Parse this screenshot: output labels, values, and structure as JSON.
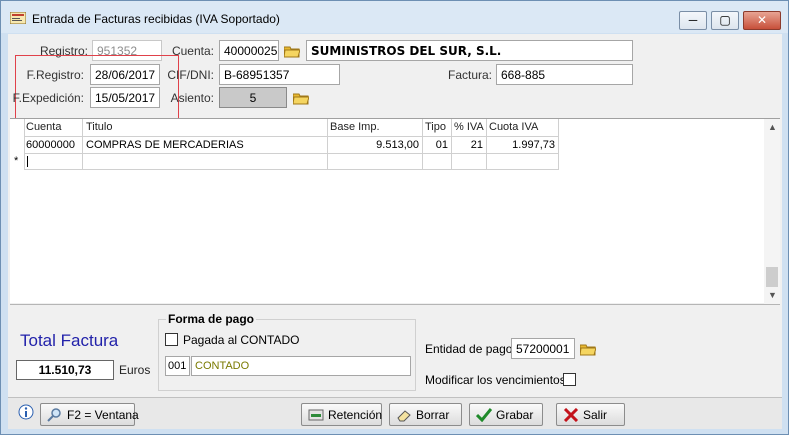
{
  "window": {
    "title": "Entrada de Facturas recibidas (IVA Soportado)",
    "controls": {
      "minimize": "─",
      "maximize": "▢",
      "close": "✕"
    }
  },
  "header": {
    "registro_label": "Registro:",
    "registro_value": "951352",
    "cuenta_label": "Cuenta:",
    "cuenta_value": "40000025",
    "cuenta_name": "SUMINISTROS DEL SUR, S.L.",
    "fregistro_label": "F.Registro:",
    "fregistro_value": "28/06/2017",
    "cif_label": "CIF/DNI:",
    "cif_value": "B-68951357",
    "factura_label": "Factura:",
    "factura_value": "668-885",
    "fexpedicion_label": "F.Expedición:",
    "fexpedicion_value": "15/05/2017",
    "asiento_label": "Asiento:",
    "asiento_value": "5"
  },
  "grid": {
    "columns": [
      "Cuenta",
      "Titulo",
      "Base Imp.",
      "Tipo",
      "% IVA",
      "Cuota IVA"
    ],
    "rows": [
      [
        "60000000",
        "COMPRAS DE MERCADERIAS",
        "9.513,00",
        "01",
        "21",
        "1.997,73"
      ]
    ],
    "new_row_marker": "*"
  },
  "totals": {
    "label": "Total Factura",
    "value": "11.510,73",
    "currency": "Euros"
  },
  "forma_pago": {
    "title": "Forma de pago",
    "pagada_label": "Pagada al CONTADO",
    "code": "001",
    "description": "CONTADO"
  },
  "entidad": {
    "entidad_label": "Entidad de pago:",
    "entidad_value": "57200001",
    "modificar_label": "Modificar los vencimientos:"
  },
  "toolbar": {
    "f2_label": "F2 = Ventana",
    "retencion_label": "Retención",
    "borrar_label": "Borrar",
    "grabar_label": "Grabar",
    "salir_label": "Salir"
  },
  "colors": {
    "accent_blue": "#2222aa",
    "highlight_red": "#e0414a",
    "grabar_green": "#1f8a2a",
    "salir_red": "#c3121b"
  },
  "icons": [
    "app-icon",
    "folder-icon",
    "info-icon",
    "search-icon",
    "retencion-icon",
    "eraser-icon",
    "check-icon",
    "x-icon"
  ]
}
